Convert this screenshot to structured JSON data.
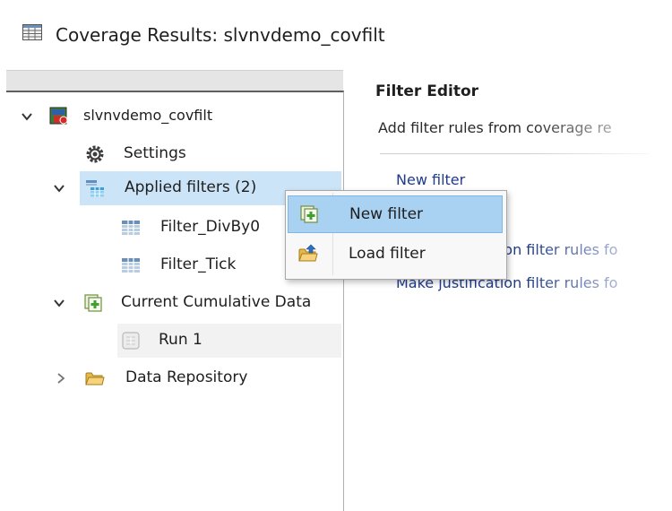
{
  "window": {
    "title": "Coverage Results: slvnvdemo_covfilt"
  },
  "tree": {
    "items": [
      {
        "label": "slvnvdemo_covfilt",
        "expanded": true,
        "icon": "model-icon"
      },
      {
        "label": "Settings",
        "icon": "gear-icon"
      },
      {
        "label": "Applied filters (2)",
        "expanded": true,
        "icon": "filters-icon",
        "selected": true
      },
      {
        "label": "Filter_DivBy0",
        "icon": "filter-table-icon"
      },
      {
        "label": "Filter_Tick",
        "icon": "filter-table-icon"
      },
      {
        "label": "Current Cumulative Data",
        "expanded": true,
        "icon": "cumulative-data-icon"
      },
      {
        "label": "Run 1",
        "icon": "run-icon"
      },
      {
        "label": "Data Repository",
        "expanded": false,
        "icon": "folder-icon"
      }
    ]
  },
  "filter_editor": {
    "title": "Filter Editor",
    "description": "Add filter rules from coverage re",
    "links": {
      "new_filter": "New filter",
      "link2": "Make justification filter rules fo",
      "link3": "Make justification filter rules fo"
    }
  },
  "context_menu": {
    "items": [
      {
        "label": "New filter",
        "icon": "new-filter-icon",
        "highlighted": true
      },
      {
        "label": "Load filter",
        "icon": "load-folder-icon"
      }
    ]
  },
  "colors": {
    "selection": "#cce4f7",
    "menu_highlight": "#a9d1f2",
    "link": "#1f3b8c"
  }
}
